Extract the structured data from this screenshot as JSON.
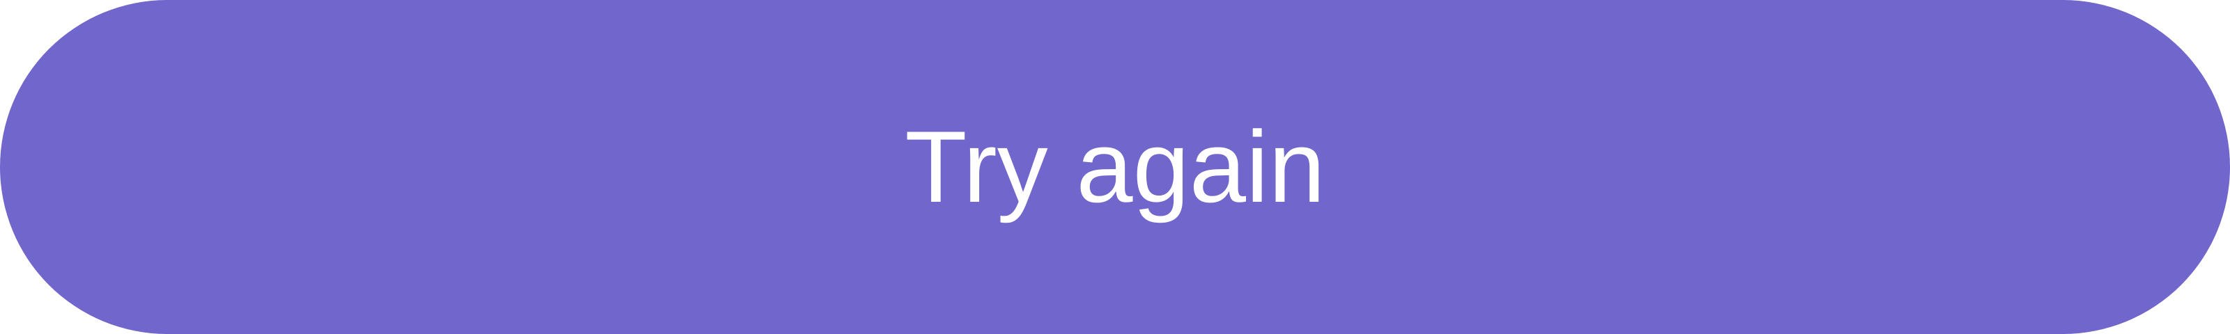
{
  "button": {
    "label": "Try again",
    "background": "#7066cc",
    "text_color": "#ffffff"
  }
}
